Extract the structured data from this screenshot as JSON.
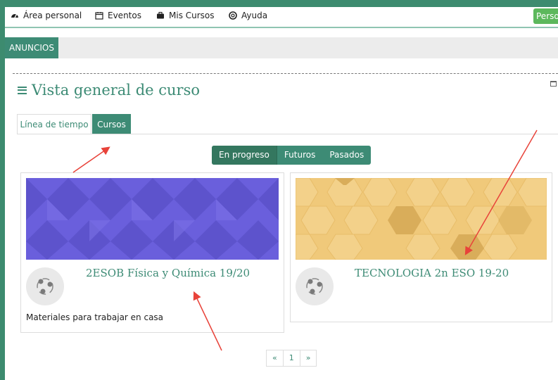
{
  "navbar": {
    "items": [
      {
        "label": "Área personal",
        "icon": "dashboard-icon"
      },
      {
        "label": "Eventos",
        "icon": "calendar-icon"
      },
      {
        "label": "Mis Cursos",
        "icon": "briefcase-icon"
      },
      {
        "label": "Ayuda",
        "icon": "lifebuoy-icon"
      }
    ],
    "personal_button": "Person"
  },
  "announcements_tab": "ANUNCIOS",
  "section": {
    "title": "Vista general de curso",
    "tabs": [
      "Línea de tiempo",
      "Cursos"
    ],
    "active_tab": "Cursos"
  },
  "filters": {
    "options": [
      "En progreso",
      "Futuros",
      "Pasados"
    ],
    "selected": "En progreso"
  },
  "courses": [
    {
      "name": "2ESOB Física y Química 19/20",
      "summary": "Materiales para trabajar en casa",
      "banner_color": "#6a5fdc"
    },
    {
      "name": "TECNOLOGIA 2n ESO 19-20",
      "summary": "",
      "banner_color": "#f0c97a"
    }
  ],
  "pagination": {
    "prev": "«",
    "current": "1",
    "next": "»"
  },
  "colors": {
    "accent": "#3d8b75",
    "success": "#5cb85c",
    "annotation_arrow": "#e8433a"
  }
}
